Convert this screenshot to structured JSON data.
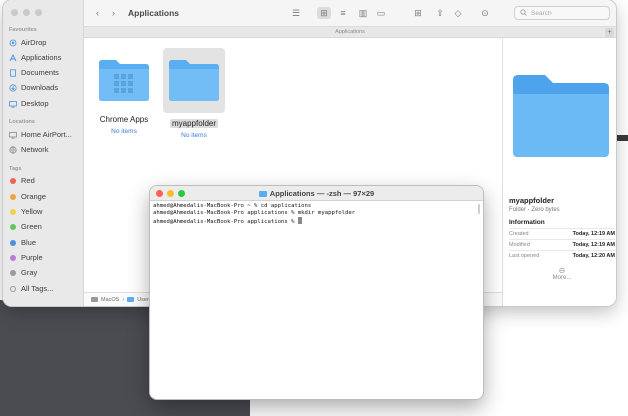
{
  "finder": {
    "title": "Applications",
    "tab_label": "Applications",
    "search_placeholder": "Search",
    "sidebar": {
      "favourites_heading": "Favourites",
      "favourites": [
        {
          "label": "AirDrop",
          "icon": "airdrop-icon"
        },
        {
          "label": "Applications",
          "icon": "applications-icon"
        },
        {
          "label": "Documents",
          "icon": "document-icon"
        },
        {
          "label": "Downloads",
          "icon": "downloads-icon"
        },
        {
          "label": "Desktop",
          "icon": "desktop-icon"
        }
      ],
      "locations_heading": "Locations",
      "locations": [
        {
          "label": "Home AirPort...",
          "icon": "display-icon"
        },
        {
          "label": "Network",
          "icon": "network-icon"
        }
      ],
      "tags_heading": "Tags",
      "tags": [
        {
          "label": "Red",
          "color": "#f25f5c"
        },
        {
          "label": "Orange",
          "color": "#f5a23a"
        },
        {
          "label": "Yellow",
          "color": "#f2d24a"
        },
        {
          "label": "Green",
          "color": "#5fc957"
        },
        {
          "label": "Blue",
          "color": "#4a90e0"
        },
        {
          "label": "Purple",
          "color": "#b57fd9"
        },
        {
          "label": "Gray",
          "color": "#9b9b9b"
        },
        {
          "label": "All Tags...",
          "color": ""
        }
      ]
    },
    "files": [
      {
        "name": "Chrome Apps",
        "sub": "No items",
        "selected": false
      },
      {
        "name": "myappfolder",
        "sub": "No items",
        "selected": true
      }
    ],
    "pathbar": [
      "MacOS",
      "Users"
    ],
    "preview": {
      "name": "myappfolder",
      "kind": "Folder - Zero bytes",
      "info_heading": "Information",
      "rows": [
        {
          "key": "Created",
          "value": "Today, 12:19 AM"
        },
        {
          "key": "Modified",
          "value": "Today, 12:19 AM"
        },
        {
          "key": "Last opened",
          "value": "Today, 12:20 AM"
        }
      ],
      "more": "More..."
    }
  },
  "terminal": {
    "title": "Applications — -zsh — 97×29",
    "lines": [
      "ahmed@Ahmedalis-MacBook-Pro ~ % cd applications",
      "ahmed@Ahmedalis-MacBook-Pro applications % mkdir myappfolder",
      "ahmed@Ahmedalis-MacBook-Pro applications % "
    ]
  },
  "colors": {
    "accent": "#4a90e0",
    "folder_blue": "#5aaef0",
    "close": "#ff5f57",
    "minimize": "#febc2e",
    "zoom": "#28c840"
  }
}
